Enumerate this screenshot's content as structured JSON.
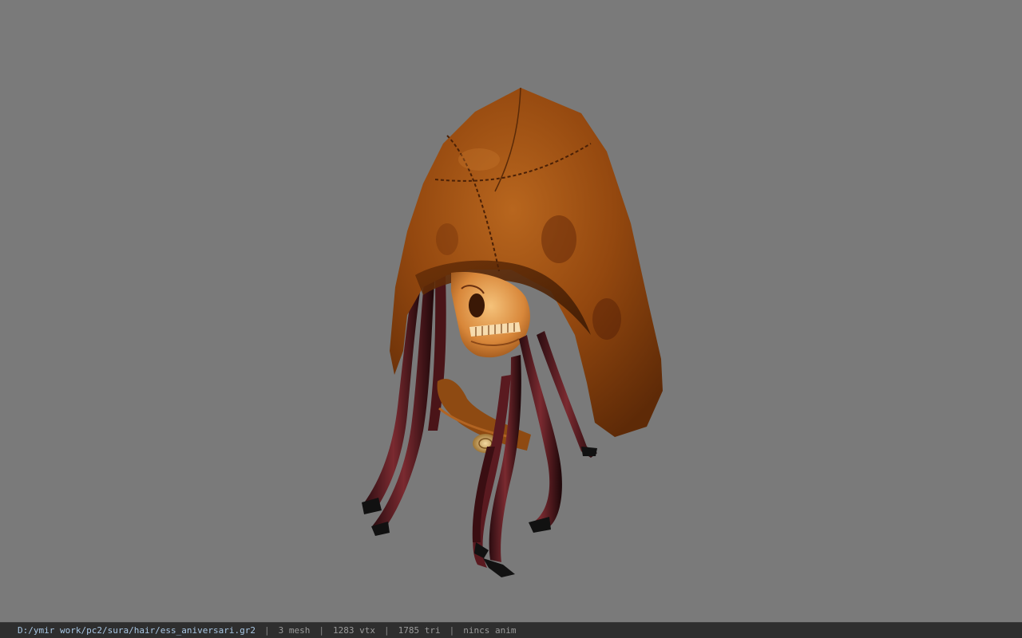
{
  "viewer": {
    "background_color": "#7a7a7a",
    "model_name": "ess_aniversari"
  },
  "status": {
    "path": "D:/ymir work/pc2/sura/hair/ess_aniversari.gr2",
    "separator": "|",
    "mesh": "3 mesh",
    "vertices": "1283 vtx",
    "triangles": "1785 tri",
    "animation": "nincs anim"
  }
}
